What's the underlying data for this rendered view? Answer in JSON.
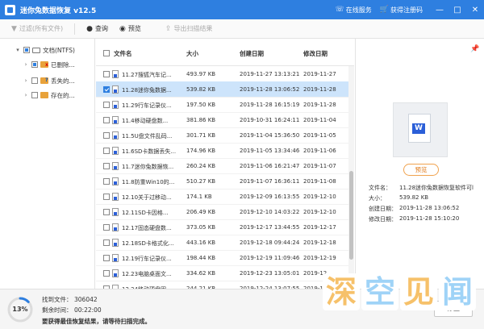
{
  "titlebar": {
    "title": "迷你兔数据恢复 v12.5",
    "online_service": "在线服务",
    "get_code": "获得注册码",
    "min": "—",
    "max": "□",
    "close": "✕"
  },
  "toolbar": {
    "filter": "过滤(所有文件)",
    "search": "查询",
    "preview": "预览",
    "export": "导出扫描结果"
  },
  "sidebar": {
    "root_label": "文档(NTFS)",
    "items": [
      {
        "label": "已删除..."
      },
      {
        "label": "丢失的..."
      },
      {
        "label": "存在的..."
      }
    ]
  },
  "list": {
    "headers": {
      "name": "文件名",
      "size": "大小",
      "created": "创建日期",
      "modified": "修改日期"
    },
    "rows": [
      {
        "name": "11.27搜狐汽车记...",
        "size": "493.97 KB",
        "created": "2019-11-27 13:13:21",
        "modified": "2019-11-27",
        "checked": false,
        "selected": false
      },
      {
        "name": "11.28迷你兔数据...",
        "size": "539.82 KB",
        "created": "2019-11-28 13:06:52",
        "modified": "2019-11-28",
        "checked": true,
        "selected": true
      },
      {
        "name": "11.29行车记录仪...",
        "size": "197.50 KB",
        "created": "2019-11-28 16:15:19",
        "modified": "2019-11-28",
        "checked": false,
        "selected": false
      },
      {
        "name": "11.4移动硬盘数...",
        "size": "381.86 KB",
        "created": "2019-10-31 16:24:11",
        "modified": "2019-11-04",
        "checked": false,
        "selected": false
      },
      {
        "name": "11.5U盘文件乱码...",
        "size": "301.71 KB",
        "created": "2019-11-04 15:36:50",
        "modified": "2019-11-05",
        "checked": false,
        "selected": false
      },
      {
        "name": "11.6SD卡数据丢失...",
        "size": "174.96 KB",
        "created": "2019-11-05 13:34:46",
        "modified": "2019-11-06",
        "checked": false,
        "selected": false
      },
      {
        "name": "11.7迷你兔数据恢...",
        "size": "260.24 KB",
        "created": "2019-11-06 16:21:47",
        "modified": "2019-11-07",
        "checked": false,
        "selected": false
      },
      {
        "name": "11.8防重Win10的...",
        "size": "510.27 KB",
        "created": "2019-11-07 16:36:11",
        "modified": "2019-11-08",
        "checked": false,
        "selected": false
      },
      {
        "name": "12.10关于过移动...",
        "size": "174.1 KB",
        "created": "2019-12-09 16:13:55",
        "modified": "2019-12-10",
        "checked": false,
        "selected": false
      },
      {
        "name": "12.11SD卡因格...",
        "size": "206.49 KB",
        "created": "2019-12-10 14:03:22",
        "modified": "2019-12-10",
        "checked": false,
        "selected": false
      },
      {
        "name": "12.17固态硬盘数...",
        "size": "373.05 KB",
        "created": "2019-12-17 13:44:55",
        "modified": "2019-12-17",
        "checked": false,
        "selected": false
      },
      {
        "name": "12.18SD卡格式化...",
        "size": "443.16 KB",
        "created": "2019-12-18 09:44:24",
        "modified": "2019-12-18",
        "checked": false,
        "selected": false
      },
      {
        "name": "12.19行车记录仪...",
        "size": "198.44 KB",
        "created": "2019-12-19 11:09:46",
        "modified": "2019-12-19",
        "checked": false,
        "selected": false
      },
      {
        "name": "12.23电脑桌面文...",
        "size": "334.62 KB",
        "created": "2019-12-23 13:05:01",
        "modified": "2019-12",
        "checked": false,
        "selected": false
      },
      {
        "name": "12.24移动硬盘因...",
        "size": "244.21 KB",
        "created": "2019-12-24 13:07:55",
        "modified": "2019-12",
        "checked": false,
        "selected": false
      }
    ]
  },
  "preview": {
    "button": "预览",
    "doc_letter": "W",
    "info": [
      {
        "label": "文件名：",
        "value": "11.28迷你兔数据恢复软件可l"
      },
      {
        "label": "大小：",
        "value": "539.82 KB"
      },
      {
        "label": "创建日期：",
        "value": "2019-11-28 13:06:52"
      },
      {
        "label": "修改日期：",
        "value": "2019-11-28 15:10:20"
      }
    ]
  },
  "status": {
    "progress": 13,
    "progress_text": "13%",
    "found_label": "找到文件：",
    "found_value": "306042",
    "remaining_label": "剩余时间：",
    "remaining_value": "00:22:00",
    "message": "要获得最佳恢复结果，请等待扫描完成。",
    "stop": "停止"
  },
  "watermark": {
    "chars": [
      "深",
      "空",
      "见",
      "闻"
    ]
  },
  "colors": {
    "accent": "#2e7fe0",
    "selected_row": "#cde4fb",
    "preview_button": "#f0a24e"
  }
}
